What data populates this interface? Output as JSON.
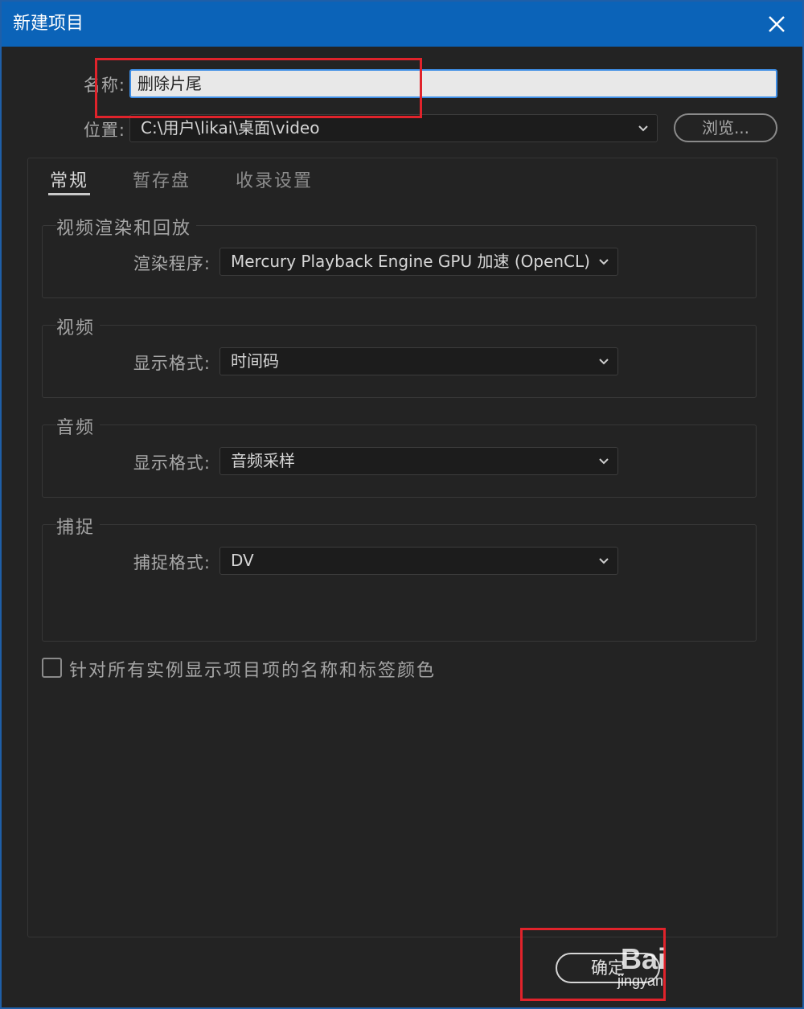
{
  "window": {
    "title": "新建项目"
  },
  "fields": {
    "name_label": "名称:",
    "name_value": "删除片尾",
    "location_label": "位置:",
    "location_value": "C:\\用户\\likai\\桌面\\video",
    "browse_label": "浏览..."
  },
  "tabs": [
    {
      "label": "常规",
      "active": true
    },
    {
      "label": "暂存盘",
      "active": false
    },
    {
      "label": "收录设置",
      "active": false
    }
  ],
  "sections": {
    "render": {
      "title": "视频渲染和回放",
      "label": "渲染程序:",
      "value": "Mercury Playback Engine GPU 加速 (OpenCL)"
    },
    "video": {
      "title": "视频",
      "label": "显示格式:",
      "value": "时间码"
    },
    "audio": {
      "title": "音频",
      "label": "显示格式:",
      "value": "音频采样"
    },
    "capture": {
      "title": "捕捉",
      "label": "捕捉格式:",
      "value": "DV"
    }
  },
  "checkbox": {
    "label": "针对所有实例显示项目项的名称和标签颜色",
    "checked": false
  },
  "buttons": {
    "ok_label": "确定"
  },
  "watermark": {
    "main": "Bai",
    "sub": "jingyan"
  },
  "colors": {
    "titlebar": "#0b63b8",
    "background": "#232323",
    "annotation": "#e0232b",
    "focus": "#3e8ee6"
  }
}
